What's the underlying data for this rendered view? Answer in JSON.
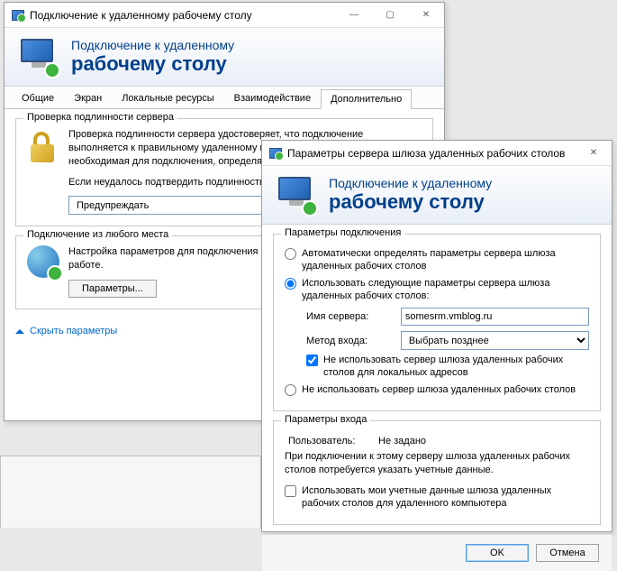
{
  "main_window": {
    "title": "Подключение к удаленному рабочему столу",
    "banner_line1": "Подключение к удаленному",
    "banner_line2": "рабочему столу",
    "tabs": [
      "Общие",
      "Экран",
      "Локальные ресурсы",
      "Взаимодействие",
      "Дополнительно"
    ],
    "active_tab_index": 4,
    "auth_group": {
      "legend": "Проверка подлинности сервера",
      "text1": "Проверка подлинности сервера удостоверяет, что подключение выполняется к правильному удаленному компьютеру. Строгость проверки, необходимая для подключения, определяется политикой безопасности.",
      "text2": "Если неудалось подтвердить подлинность удаленного компьютера:",
      "dropdown_value": "Предупреждать"
    },
    "anywhere_group": {
      "legend": "Подключение из любого места",
      "text": "Настройка параметров для подключения через шлюз при удаленной работе.",
      "btn": "Параметры..."
    },
    "hide_link": "Скрыть параметры"
  },
  "gateway_window": {
    "title": "Параметры сервера шлюза удаленных рабочих столов",
    "banner_line1": "Подключение к удаленному",
    "banner_line2": "рабочему столу",
    "conn_group": {
      "legend": "Параметры подключения",
      "radio_auto": "Автоматически определять параметры сервера шлюза удаленных рабочих столов",
      "radio_use": "Использовать следующие параметры сервера шлюза удаленных рабочих столов:",
      "server_label": "Имя сервера:",
      "server_value": "somesrm.vmblog.ru",
      "method_label": "Метод входа:",
      "method_value": "Выбрать позднее",
      "method_options": [
        "Выбрать позднее"
      ],
      "chk_bypass": "Не использовать сервер шлюза удаленных рабочих столов для локальных адресов",
      "radio_none": "Не использовать сервер шлюза удаленных рабочих столов"
    },
    "login_group": {
      "legend": "Параметры входа",
      "user_label": "Пользователь:",
      "user_value": "Не задано",
      "info": "При подключении к этому серверу шлюза удаленных рабочих столов потребуется указать учетные данные.",
      "chk_creds": "Использовать мои учетные данные шлюза удаленных рабочих столов для удаленного компьютера"
    },
    "ok": "OK",
    "cancel": "Отмена"
  }
}
